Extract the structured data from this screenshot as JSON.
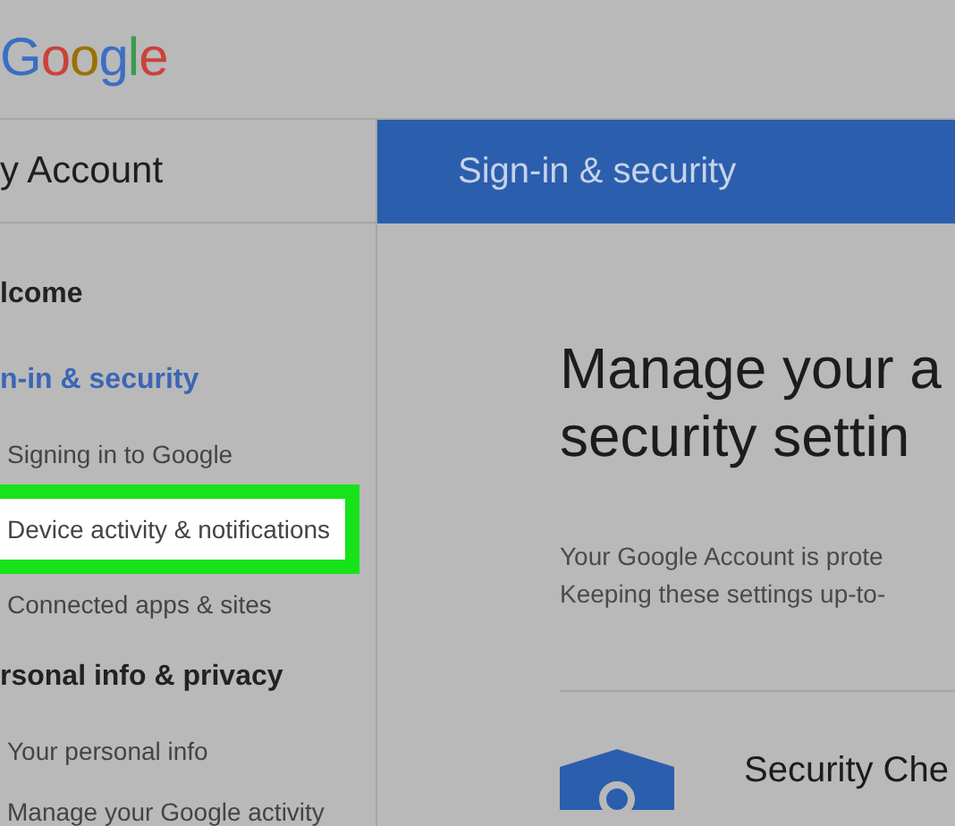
{
  "header": {
    "logo": "Google"
  },
  "sidebar": {
    "title": "y Account",
    "items": [
      {
        "label": "lcome",
        "kind": "section",
        "selected": false
      },
      {
        "label": "n-in & security",
        "kind": "section",
        "selected": true
      },
      {
        "label": "Signing in to Google",
        "kind": "sub",
        "selected": false
      },
      {
        "label": "Device activity & notifications",
        "kind": "sub",
        "selected": true
      },
      {
        "label": "Connected apps & sites",
        "kind": "sub",
        "selected": false
      },
      {
        "label": "rsonal info & privacy",
        "kind": "section",
        "selected": false
      },
      {
        "label": "Your personal info",
        "kind": "sub",
        "selected": false
      },
      {
        "label": "Manage your Google activity",
        "kind": "sub",
        "selected": false
      }
    ]
  },
  "main": {
    "banner": "Sign-in & security",
    "heading": [
      "Manage your a",
      "security settin"
    ],
    "intro": [
      "Your Google Account is prote",
      "Keeping these settings up-to-"
    ],
    "card": {
      "title": "Security Che"
    }
  }
}
